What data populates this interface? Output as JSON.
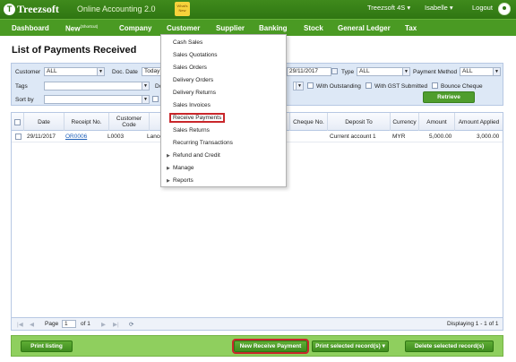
{
  "topbar": {
    "logo_mark": "T",
    "logo_text": "Treezsoft",
    "product": "Online Accounting 2.0",
    "whatsnew": "What's New",
    "company": "Treezsoft 4S ▾",
    "user": "Isabelle ▾",
    "logout": "Logout"
  },
  "nav": {
    "dashboard": "Dashboard",
    "new": "New",
    "new_sup": "(Shortcut)",
    "company": "Company",
    "customer": "Customer",
    "supplier": "Supplier",
    "banking": "Banking",
    "stock": "Stock",
    "general_ledger": "General Ledger",
    "tax": "Tax"
  },
  "page_title": "List of Payments Received",
  "filters": {
    "customer_label": "Customer",
    "customer_value": "ALL",
    "doc_date_label": "Doc. Date",
    "doc_date_value": "Today",
    "to_date_value": "29/11/2017",
    "type_label": "Type",
    "type_value": "ALL",
    "payment_method_label": "Payment Method",
    "payment_method_value": "ALL",
    "tags_label": "Tags",
    "tags_value": "",
    "do_label": "Do",
    "with_outstanding": "With Outstanding",
    "with_gst": "With GST Submitted",
    "bounce_cheque": "Bounce Cheque",
    "sort_by_label": "Sort by",
    "sort_by_value": "",
    "retrieve": "Retrieve"
  },
  "table": {
    "headers": [
      "Date",
      "Receipt No.",
      "Customer Code",
      "Cheque No.",
      "Deposit To",
      "Currency",
      "Amount",
      "Amount Applied"
    ],
    "rows": [
      {
        "date": "29/11/2017",
        "receipt": "OR0006",
        "customer_code": "L0003",
        "customer_name": "Lance",
        "cheque": "",
        "deposit_to": "Current account 1",
        "currency": "MYR",
        "amount": "5,000.00",
        "applied": "3,000.00"
      }
    ]
  },
  "pager": {
    "page_label": "Page",
    "page_value": "1",
    "of_label": "of 1",
    "displaying": "Displaying 1 - 1 of 1"
  },
  "footer": {
    "print_listing": "Print listing",
    "new_receive_payment": "New Receive Payment",
    "print_selected": "Print selected record(s)",
    "delete_selected": "Delete selected record(s)"
  },
  "menu": {
    "items": [
      "Cash Sales",
      "Sales Quotations",
      "Sales Orders",
      "Delivery Orders",
      "Delivery Returns",
      "Sales Invoices",
      "Receive Payments",
      "Sales Returns",
      "Recurring Transactions",
      "Refund and Credit",
      "Manage",
      "Reports"
    ]
  },
  "colors": {
    "brand_green": "#3f8a1c",
    "highlight_red": "#c9272b",
    "panel_blue": "#dde8f6"
  }
}
